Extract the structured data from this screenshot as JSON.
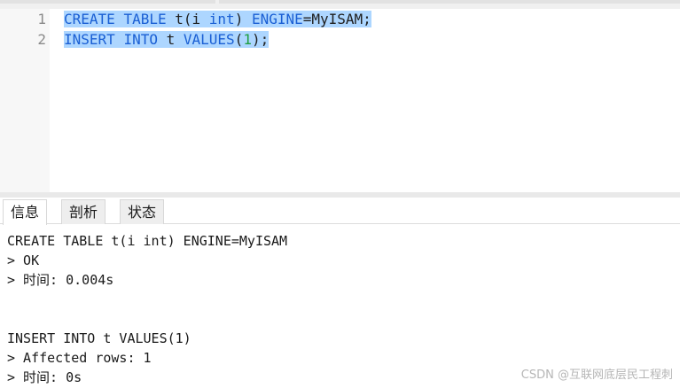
{
  "editor": {
    "lines": [
      {
        "number": "1",
        "tokens": [
          "CREATE",
          " ",
          "TABLE",
          " t(i ",
          "int",
          ") ",
          "ENGINE",
          "=MyISAM;"
        ]
      },
      {
        "number": "2",
        "tokens": [
          "INSERT",
          " ",
          "INTO",
          " t ",
          "VALUES",
          "(",
          "1",
          ");"
        ]
      }
    ]
  },
  "tabs": [
    {
      "label": "信息",
      "active": true
    },
    {
      "label": "剖析",
      "active": false
    },
    {
      "label": "状态",
      "active": false
    }
  ],
  "output": {
    "lines": [
      "CREATE TABLE t(i int) ENGINE=MyISAM",
      "> OK",
      "> 时间: 0.004s",
      "",
      "",
      "INSERT INTO t VALUES(1)",
      "> Affected rows: 1",
      "> 时间: 0s"
    ]
  },
  "watermark": "CSDN @互联网底层民工程刺",
  "colors": {
    "keyword": "#1a5fd4",
    "number": "#1f9e3f",
    "selection": "#add6ff"
  }
}
